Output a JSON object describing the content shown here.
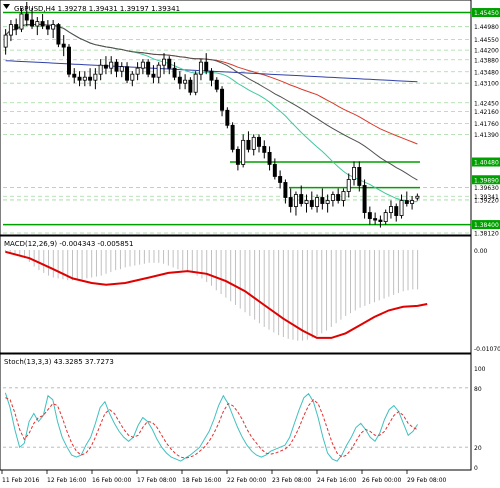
{
  "main": {
    "header": "GBPUSD,H4  1.39278 1.39431 1.39197 1.39341",
    "price_labels": [
      "1.45450",
      "1.44980",
      "1.44550",
      "1.44200",
      "1.43880",
      "1.43480",
      "1.43100",
      "1.42450",
      "1.42160",
      "1.41760",
      "1.41390",
      "1.40480",
      "1.39890",
      "1.39630",
      "1.39341",
      "1.39220",
      "1.38400",
      "1.38120"
    ],
    "hlines": [
      1.4545,
      1.4048,
      1.3963,
      1.384
    ],
    "green_label_indices": [
      0,
      11,
      12,
      16
    ]
  },
  "macd": {
    "header": "MACD(12,26,9) -0.004343 -0.005851",
    "top_label": "0.00",
    "bottom_label": "-0.010707"
  },
  "stoch": {
    "header": "Stoch(13,3,3) 43.3285 37.7273",
    "labels": [
      "100",
      "80",
      "20",
      "0"
    ]
  },
  "time_labels": [
    "11 Feb 2016",
    "12 Feb 16:00",
    "16 Feb 00:00",
    "17 Feb 08:00",
    "18 Feb 16:00",
    "22 Feb 00:00",
    "23 Feb 08:00",
    "24 Feb 16:00",
    "26 Feb 00:00",
    "29 Feb 08:00"
  ],
  "colors": {
    "green": "#00a000",
    "ma_red": "#d73c2c",
    "ma_blue": "#3040a8",
    "ma_teal": "#40c8a0",
    "ma_black": "#505050",
    "macd_signal": "#e00000",
    "macd_hist": "#c0c0c0",
    "stoch_main": "#40c0c0",
    "stoch_signal": "#e03030",
    "axis_label_bg": "#00a000"
  },
  "chart_data": [
    {
      "type": "candlestick",
      "title": "GBPUSD,H4",
      "last": {
        "open": 1.39278,
        "high": 1.39431,
        "low": 1.39197,
        "close": 1.39341
      },
      "ylim": [
        1.3812,
        1.458
      ],
      "candles": [
        [
          1.443,
          1.449,
          1.4405,
          1.447
        ],
        [
          1.447,
          1.452,
          1.445,
          1.4505
        ],
        [
          1.4505,
          1.4525,
          1.447,
          1.449
        ],
        [
          1.449,
          1.456,
          1.448,
          1.454
        ],
        [
          1.454,
          1.458,
          1.45,
          1.452
        ],
        [
          1.452,
          1.456,
          1.449,
          1.45
        ],
        [
          1.45,
          1.453,
          1.447,
          1.4515
        ],
        [
          1.4515,
          1.454,
          1.449,
          1.45
        ],
        [
          1.45,
          1.452,
          1.447,
          1.449
        ],
        [
          1.449,
          1.452,
          1.446,
          1.4505
        ],
        [
          1.4505,
          1.451,
          1.443,
          1.444
        ],
        [
          1.444,
          1.447,
          1.44,
          1.443
        ],
        [
          1.443,
          1.444,
          1.433,
          1.434
        ],
        [
          1.434,
          1.436,
          1.431,
          1.433
        ],
        [
          1.433,
          1.435,
          1.43,
          1.432
        ],
        [
          1.432,
          1.435,
          1.43,
          1.433
        ],
        [
          1.433,
          1.436,
          1.43,
          1.432
        ],
        [
          1.432,
          1.436,
          1.429,
          1.434
        ],
        [
          1.434,
          1.439,
          1.432,
          1.437
        ],
        [
          1.437,
          1.44,
          1.434,
          1.436
        ],
        [
          1.436,
          1.44,
          1.434,
          1.438
        ],
        [
          1.438,
          1.439,
          1.433,
          1.435
        ],
        [
          1.435,
          1.438,
          1.433,
          1.4365
        ],
        [
          1.4365,
          1.438,
          1.431,
          1.432
        ],
        [
          1.432,
          1.435,
          1.43,
          1.434
        ],
        [
          1.434,
          1.438,
          1.432,
          1.436
        ],
        [
          1.436,
          1.439,
          1.434,
          1.438
        ],
        [
          1.438,
          1.439,
          1.433,
          1.434
        ],
        [
          1.434,
          1.437,
          1.431,
          1.433
        ],
        [
          1.433,
          1.438,
          1.431,
          1.437
        ],
        [
          1.437,
          1.441,
          1.434,
          1.439
        ],
        [
          1.439,
          1.44,
          1.434,
          1.436
        ],
        [
          1.436,
          1.438,
          1.432,
          1.433
        ],
        [
          1.433,
          1.435,
          1.429,
          1.431
        ],
        [
          1.431,
          1.434,
          1.429,
          1.432
        ],
        [
          1.432,
          1.433,
          1.427,
          1.428
        ],
        [
          1.428,
          1.435,
          1.427,
          1.434
        ],
        [
          1.434,
          1.439,
          1.432,
          1.438
        ],
        [
          1.438,
          1.441,
          1.434,
          1.435
        ],
        [
          1.435,
          1.436,
          1.43,
          1.432
        ],
        [
          1.432,
          1.433,
          1.428,
          1.429
        ],
        [
          1.429,
          1.43,
          1.42,
          1.422
        ],
        [
          1.422,
          1.423,
          1.416,
          1.417
        ],
        [
          1.417,
          1.418,
          1.408,
          1.409
        ],
        [
          1.409,
          1.41,
          1.402,
          1.404
        ],
        [
          1.404,
          1.414,
          1.403,
          1.412
        ],
        [
          1.412,
          1.415,
          1.408,
          1.409
        ],
        [
          1.409,
          1.414,
          1.407,
          1.413
        ],
        [
          1.413,
          1.414,
          1.408,
          1.41
        ],
        [
          1.41,
          1.412,
          1.406,
          1.408
        ],
        [
          1.408,
          1.41,
          1.402,
          1.404
        ],
        [
          1.404,
          1.406,
          1.399,
          1.4
        ],
        [
          1.4,
          1.402,
          1.396,
          1.398
        ],
        [
          1.398,
          1.399,
          1.391,
          1.393
        ],
        [
          1.393,
          1.396,
          1.388,
          1.39
        ],
        [
          1.39,
          1.395,
          1.387,
          1.394
        ],
        [
          1.394,
          1.397,
          1.39,
          1.391
        ],
        [
          1.391,
          1.394,
          1.388,
          1.392
        ],
        [
          1.392,
          1.395,
          1.389,
          1.39
        ],
        [
          1.39,
          1.394,
          1.388,
          1.393
        ],
        [
          1.393,
          1.396,
          1.389,
          1.391
        ],
        [
          1.391,
          1.394,
          1.388,
          1.392
        ],
        [
          1.392,
          1.395,
          1.39,
          1.394
        ],
        [
          1.394,
          1.396,
          1.391,
          1.392
        ],
        [
          1.392,
          1.396,
          1.39,
          1.395
        ],
        [
          1.395,
          1.401,
          1.393,
          1.399
        ],
        [
          1.399,
          1.405,
          1.397,
          1.403
        ],
        [
          1.403,
          1.405,
          1.395,
          1.397
        ],
        [
          1.397,
          1.399,
          1.386,
          1.388
        ],
        [
          1.388,
          1.39,
          1.384,
          1.386
        ],
        [
          1.386,
          1.388,
          1.384,
          1.3855
        ],
        [
          1.3855,
          1.387,
          1.383,
          1.385
        ],
        [
          1.385,
          1.389,
          1.384,
          1.388
        ],
        [
          1.388,
          1.392,
          1.386,
          1.39
        ],
        [
          1.39,
          1.391,
          1.385,
          1.387
        ],
        [
          1.387,
          1.394,
          1.386,
          1.392
        ],
        [
          1.392,
          1.395,
          1.39,
          1.391
        ],
        [
          1.391,
          1.3935,
          1.389,
          1.392
        ],
        [
          1.39278,
          1.39431,
          1.39197,
          1.39341
        ]
      ]
    },
    {
      "type": "line",
      "title": "MACD(12,26,9)",
      "ylim": [
        -0.0107,
        0.0
      ],
      "signal_path": [
        [
          0,
          -0.0002
        ],
        [
          5,
          -0.0009
        ],
        [
          10,
          -0.0021
        ],
        [
          14,
          -0.0031
        ],
        [
          18,
          -0.0036
        ],
        [
          21,
          -0.0038
        ],
        [
          25,
          -0.0036
        ],
        [
          30,
          -0.003
        ],
        [
          34,
          -0.0025
        ],
        [
          38,
          -0.0023
        ],
        [
          42,
          -0.0026
        ],
        [
          46,
          -0.0034
        ],
        [
          50,
          -0.0045
        ],
        [
          54,
          -0.006
        ],
        [
          58,
          -0.0075
        ],
        [
          62,
          -0.0088
        ],
        [
          65,
          -0.0096
        ],
        [
          68,
          -0.0096
        ],
        [
          71,
          -0.0091
        ],
        [
          74,
          -0.0082
        ],
        [
          77,
          -0.0073
        ],
        [
          80,
          -0.0066
        ],
        [
          83,
          -0.0062
        ],
        [
          86,
          -0.0061
        ],
        [
          88,
          -0.0059
        ]
      ],
      "histogram": [
        -0.0002,
        -0.0003,
        -0.0004,
        -0.0006,
        -0.0009,
        -0.0013,
        -0.0018,
        -0.0022,
        -0.0025,
        -0.0028,
        -0.003,
        -0.0031,
        -0.0032,
        -0.0033,
        -0.0033,
        -0.0033,
        -0.0032,
        -0.0031,
        -0.003,
        -0.0029,
        -0.0028,
        -0.0026,
        -0.0024,
        -0.0022,
        -0.0021,
        -0.0019,
        -0.0018,
        -0.0017,
        -0.0016,
        -0.0015,
        -0.0014,
        -0.0014,
        -0.0014,
        -0.0015,
        -0.0017,
        -0.0019,
        -0.0021,
        -0.0022,
        -0.0023,
        -0.0025,
        -0.0028,
        -0.0031,
        -0.0035,
        -0.0039,
        -0.0044,
        -0.0048,
        -0.0052,
        -0.0056,
        -0.006,
        -0.0064,
        -0.0068,
        -0.0072,
        -0.0076,
        -0.008,
        -0.0084,
        -0.0087,
        -0.009,
        -0.0093,
        -0.0095,
        -0.0097,
        -0.0098,
        -0.0099,
        -0.0099,
        -0.0098,
        -0.0096,
        -0.0094,
        -0.0091,
        -0.0088,
        -0.0084,
        -0.008,
        -0.0076,
        -0.0072,
        -0.0069,
        -0.0066,
        -0.0063,
        -0.0061,
        -0.0059,
        -0.0057,
        -0.0055,
        -0.0053,
        -0.0051,
        -0.0049,
        -0.0047,
        -0.0045,
        -0.0044,
        -0.0043,
        -0.0043
      ]
    },
    {
      "type": "line",
      "title": "Stoch(13,3,3)",
      "ylim": [
        0,
        100
      ],
      "series": [
        {
          "name": "main",
          "values": [
            75,
            60,
            38,
            20,
            24,
            46,
            54,
            46,
            52,
            72,
            68,
            46,
            30,
            20,
            12,
            10,
            12,
            22,
            30,
            44,
            60,
            66,
            54,
            44,
            36,
            30,
            26,
            30,
            42,
            50,
            46,
            38,
            28,
            20,
            14,
            10,
            8,
            6,
            9,
            12,
            16,
            20,
            28,
            36,
            48,
            62,
            72,
            64,
            52,
            40,
            30,
            22,
            16,
            12,
            10,
            12,
            16,
            18,
            20,
            22,
            30,
            44,
            58,
            70,
            74,
            66,
            50,
            30,
            14,
            8,
            6,
            12,
            22,
            30,
            40,
            44,
            38,
            30,
            26,
            34,
            48,
            58,
            62,
            56,
            44,
            32,
            36,
            43
          ]
        },
        {
          "name": "signal",
          "values": [
            70,
            68,
            55,
            38,
            28,
            34,
            44,
            50,
            52,
            58,
            64,
            62,
            50,
            36,
            24,
            16,
            12,
            14,
            20,
            30,
            42,
            54,
            58,
            54,
            46,
            38,
            32,
            30,
            32,
            40,
            46,
            45,
            40,
            32,
            24,
            18,
            13,
            10,
            9,
            10,
            12,
            16,
            20,
            26,
            34,
            44,
            56,
            64,
            62,
            56,
            48,
            38,
            30,
            24,
            18,
            14,
            13,
            14,
            16,
            18,
            22,
            30,
            40,
            52,
            62,
            68,
            64,
            52,
            38,
            24,
            14,
            10,
            12,
            18,
            26,
            34,
            38,
            36,
            32,
            32,
            36,
            44,
            52,
            56,
            52,
            44,
            40,
            37.7
          ]
        }
      ]
    }
  ]
}
